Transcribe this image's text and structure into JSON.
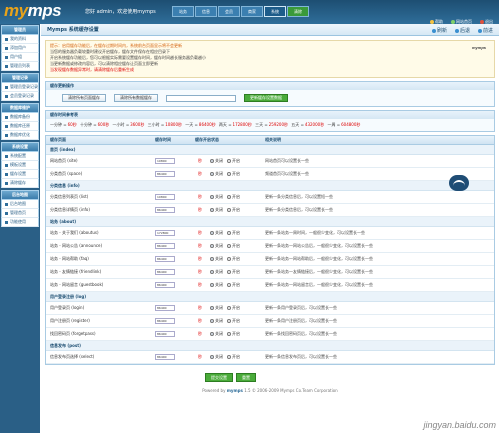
{
  "header": {
    "logo_a": "my",
    "logo_b": "mps",
    "welcome": "您好 admin，欢迎使用mymps",
    "nav_tabs": [
      "站务",
      "信息",
      "会员",
      "商家",
      "系统",
      "清除"
    ],
    "links": [
      "帮助",
      "网站首页",
      "退出"
    ]
  },
  "sidebar": {
    "groups": [
      {
        "title": "管理员",
        "items": [
          "我的资料",
          "添加用户",
          "用户组",
          "管理员列表"
        ]
      },
      {
        "title": "管理记录",
        "items": [
          "管理员登录记录",
          "会员登录记录"
        ]
      },
      {
        "title": "数据库维护",
        "items": [
          "数据库备份",
          "数据库还原",
          "数据库优化"
        ]
      },
      {
        "title": "系统设置",
        "items": [
          "系统配置",
          "模板设置",
          "缓存设置",
          "清除缓存"
        ]
      },
      {
        "title": "后台地图",
        "items": [
          "后台地图",
          "管理首页",
          "功能使用"
        ]
      }
    ]
  },
  "titlebar": {
    "title": "Mymps 系统缓存设置",
    "links": [
      "刷新",
      "后退",
      "前进"
    ]
  },
  "notice": {
    "line1": "提示：启用缓存功能后，在缓存过期时间内，系统前台页面显示将不会更新",
    "line2": "当您的服务器负载较重时建议开启缓存，缓存文件保存在相应目录下",
    "line3": "开启系统缓存功能后，您可以根据实际需要设置缓存时间，缓存时间越长服务器负载越小",
    "line4": "当更新数据或修改内容后，可以清除相应缓存让页面立即更新",
    "line5": "当发现缓存数据异常时，请清除缓存后重新生成",
    "watermark": "mymps"
  },
  "ops": {
    "title": "缓存更新操作",
    "btn_clear_pages": "清除所有页面缓存",
    "btn_clear_data": "清除所有数据缓存",
    "btn_update": "更新缓存设置数据"
  },
  "stats": {
    "title": "缓存时间参考表",
    "items": [
      {
        "label": "一分钟 =",
        "val": "60秒"
      },
      {
        "label": "十分钟 =",
        "val": "600秒"
      },
      {
        "label": "一小时 =",
        "val": "3600秒"
      },
      {
        "label": "三小时 =",
        "val": "10800秒"
      },
      {
        "label": "一天 =",
        "val": "86400秒"
      },
      {
        "label": "两天 =",
        "val": "172800秒"
      },
      {
        "label": "三天 =",
        "val": "259200秒"
      },
      {
        "label": "五天 =",
        "val": "432000秒"
      },
      {
        "label": "一周 =",
        "val": "604800秒"
      }
    ]
  },
  "table": {
    "headers": [
      "缓存页面",
      "缓存时间",
      "缓存开启状态",
      "相关说明"
    ],
    "unit": "秒",
    "radio_on": "关闭",
    "radio_off": "开启",
    "groups": [
      {
        "title": "首页 (index)",
        "rows": [
          {
            "name": "网站首页 (site)",
            "time": "10800",
            "desc": "网站首页可以设置长一些"
          },
          {
            "name": "分类首页 (space)",
            "time": "86400",
            "desc": "频道首页可以设置长一些"
          }
        ]
      },
      {
        "title": "分类信息 (info)",
        "rows": [
          {
            "name": "分类信息列表页 (list)",
            "time": "10800",
            "desc": "更新一条分类信息后，可以设置短一些"
          },
          {
            "name": "分类信息详情页 (info)",
            "time": "86400",
            "desc": "更新一条分类信息后，可以设置长一些"
          }
        ]
      },
      {
        "title": "站务 (about)",
        "rows": [
          {
            "name": "站务 - 关于我们 (aboutus)",
            "time": "172800",
            "desc": "更新一条站务一周时间，一般很少变化，可以设置长一些"
          },
          {
            "name": "站务 - 网站公告 (announce)",
            "time": "86400",
            "desc": "更新一条站务一网站公告后，一般很少变化，可以设置长一些"
          },
          {
            "name": "站务 - 网站帮助 (faq)",
            "time": "86400",
            "desc": "更新一条站务一网站帮助后，一般很少变化，可以设置长一些"
          },
          {
            "name": "站务 - 友情链接 (friendlink)",
            "time": "86400",
            "desc": "更新一条站务一友情链接后，一般很少变化，可以设置长一些"
          },
          {
            "name": "站务 - 网站留言 (guestbook)",
            "time": "86400",
            "desc": "更新一条站务一网站留言后，一般很少变化，可以设置长一些"
          }
        ]
      },
      {
        "title": "用户登录注册 (log)",
        "rows": [
          {
            "name": "用户登录页 (login)",
            "time": "86400",
            "desc": "更新一条用户登录页后，可以设置长一些"
          },
          {
            "name": "用户注册页 (register)",
            "time": "86400",
            "desc": "更新一条用户注册页后，可以设置长一些"
          },
          {
            "name": "找回密码页 (forgetpass)",
            "time": "86400",
            "desc": "更新一条找回密码页后，可以设置长一些"
          }
        ]
      },
      {
        "title": "信息发布 (post)",
        "rows": [
          {
            "name": "信息发布页选择 (select)",
            "time": "86400",
            "desc": "更新一条信息发布页后，可以设置长一些"
          }
        ]
      }
    ]
  },
  "bottom": {
    "submit": "提交设置",
    "reset": "重置"
  },
  "footer": {
    "text_a": "Powered by",
    "brand": "mymps",
    "text_b": "1.5 © 2006-2009 Mymps Co.Team Corporation"
  },
  "watermark": "jingyan.baidu.com"
}
